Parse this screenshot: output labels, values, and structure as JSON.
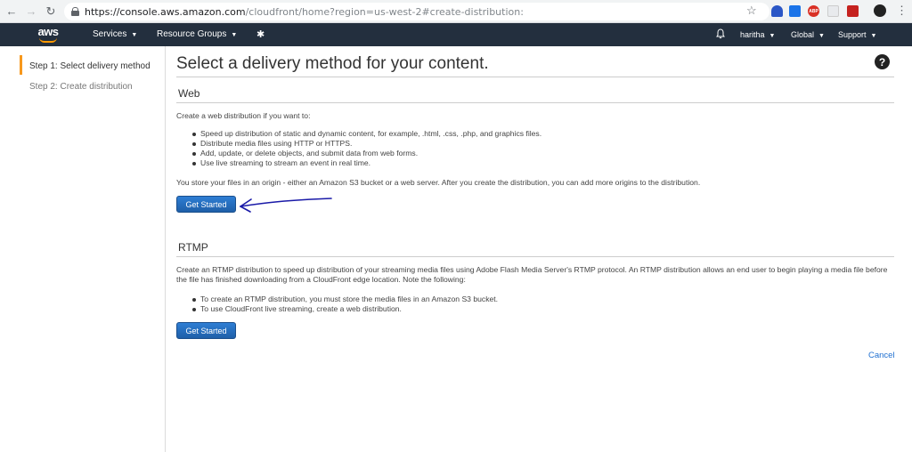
{
  "browser": {
    "url_host": "https://console.aws.amazon.com",
    "url_path": "/cloudfront/home?region=us-west-2#create-distribution:"
  },
  "topnav": {
    "logo": "aws",
    "services": "Services",
    "resource_groups": "Resource Groups",
    "user": "haritha",
    "region": "Global",
    "support": "Support"
  },
  "sidebar": {
    "steps": [
      {
        "label": "Step 1: Select delivery method",
        "active": true
      },
      {
        "label": "Step 2: Create distribution",
        "active": false
      }
    ]
  },
  "main": {
    "title": "Select a delivery method for your content.",
    "help": "?",
    "web": {
      "heading": "Web",
      "intro": "Create a web distribution if you want to:",
      "bullets": [
        "Speed up distribution of static and dynamic content, for example, .html, .css, .php, and graphics files.",
        "Distribute media files using HTTP or HTTPS.",
        "Add, update, or delete objects, and submit data from web forms.",
        "Use live streaming to stream an event in real time."
      ],
      "origin_note": "You store your files in an origin - either an Amazon S3 bucket or a web server. After you create the distribution, you can add more origins to the distribution.",
      "button": "Get Started"
    },
    "rtmp": {
      "heading": "RTMP",
      "intro": "Create an RTMP distribution to speed up distribution of your streaming media files using Adobe Flash Media Server's RTMP protocol. An RTMP distribution allows an end user to begin playing a media file before the file has finished downloading from a CloudFront edge location. Note the following:",
      "bullets": [
        "To create an RTMP distribution, you must store the media files in an Amazon S3 bucket.",
        "To use CloudFront live streaming, create a web distribution."
      ],
      "button": "Get Started"
    },
    "cancel": "Cancel"
  },
  "colors": {
    "nav_bg": "#232f3e",
    "accent_orange": "#f7981d",
    "button_blue": "#1f6fd0",
    "annotation_ink": "#1a1aa8"
  }
}
